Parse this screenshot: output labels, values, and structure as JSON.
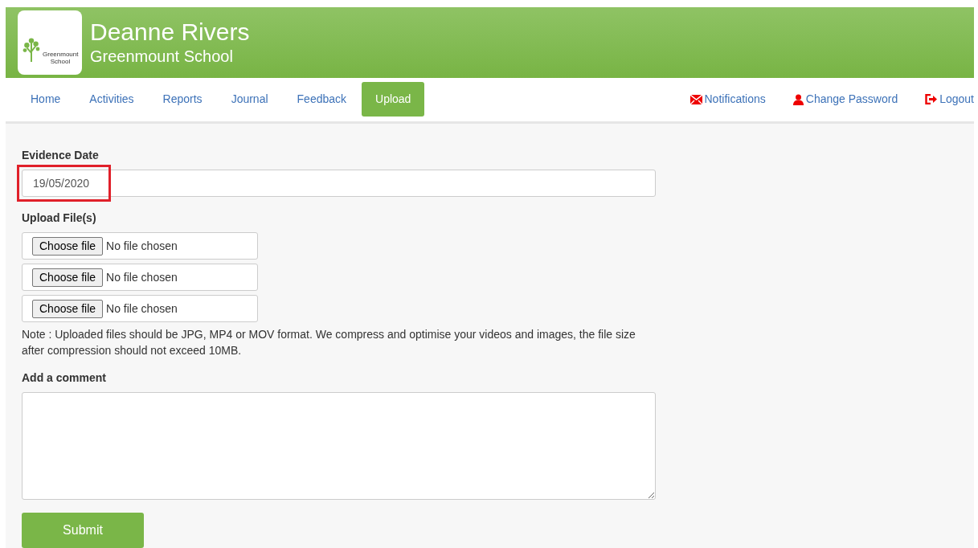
{
  "header": {
    "logo_text": "Greenmount School",
    "name": "Deanne Rivers",
    "school": "Greenmount School"
  },
  "nav": [
    {
      "label": "Home",
      "selected": false
    },
    {
      "label": "Activities",
      "selected": false
    },
    {
      "label": "Reports",
      "selected": false
    },
    {
      "label": "Journal",
      "selected": false
    },
    {
      "label": "Feedback",
      "selected": false
    },
    {
      "label": "Upload",
      "selected": true
    }
  ],
  "nav_right": [
    {
      "kind": "mail",
      "label": "Notifications"
    },
    {
      "kind": "user",
      "label": "Change Password"
    },
    {
      "kind": "logout",
      "label": "Logout"
    }
  ],
  "form": {
    "date_label": "Evidence Date",
    "date_value": "19/05/2020",
    "date_highlighted": true,
    "upload_label": "Upload File(s)",
    "files": [
      {
        "button": "Choose file",
        "status": "No file chosen"
      },
      {
        "button": "Choose file",
        "status": "No file chosen"
      },
      {
        "button": "Choose file",
        "status": "No file chosen"
      }
    ],
    "note": "Note : Uploaded files should be JPG, MP4 or MOV format. We compress and optimise your videos and images, the file size after compression should not exceed 10MB.",
    "comment_label": "Add a comment",
    "submit": "Submit"
  }
}
